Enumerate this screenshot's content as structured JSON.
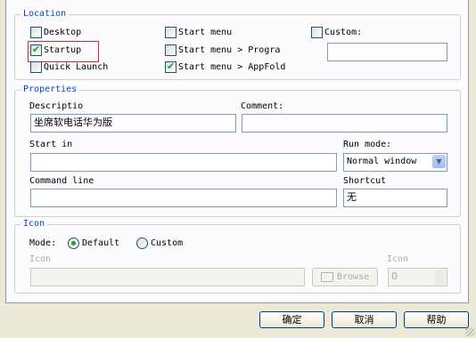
{
  "location": {
    "legend": "Location",
    "desktop": {
      "label": "Desktop",
      "checked": false
    },
    "startup": {
      "label": "Startup",
      "checked": true
    },
    "quick_launch": {
      "label": "Quick Launch",
      "checked": false
    },
    "start_menu": {
      "label": "Start menu",
      "checked": false
    },
    "start_menu_programs": {
      "label": "Start menu > Progra",
      "checked": false
    },
    "start_menu_appfold": {
      "label": "Start menu > AppFold",
      "checked": true
    },
    "custom": {
      "label": "Custom:",
      "checked": false
    },
    "custom_path": ""
  },
  "properties": {
    "legend": "Properties",
    "description_label": "Descriptio",
    "description_value": "坐席软电话华为版",
    "comment_label": "Comment:",
    "comment_value": "",
    "start_in_label": "Start in",
    "start_in_value": "",
    "run_mode_label": "Run mode:",
    "run_mode_value": "Normal window",
    "command_line_label": "Command line",
    "command_line_value": "",
    "shortcut_label": "Shortcut",
    "shortcut_value": "无"
  },
  "icon": {
    "legend": "Icon",
    "mode_label": "Mode:",
    "default_label": "Default",
    "custom_label": "Custom",
    "selected": "default",
    "icon_path_label": "Icon",
    "icon_path_value": "",
    "browse_label": "Browse",
    "icon_index_label": "Icon",
    "icon_index_value": "0"
  },
  "buttons": {
    "ok": "确定",
    "cancel": "取消",
    "help": "帮助"
  },
  "colors": {
    "accent": "#0046d5",
    "checkmark": "#21a121",
    "highlight": "#e0242c"
  }
}
